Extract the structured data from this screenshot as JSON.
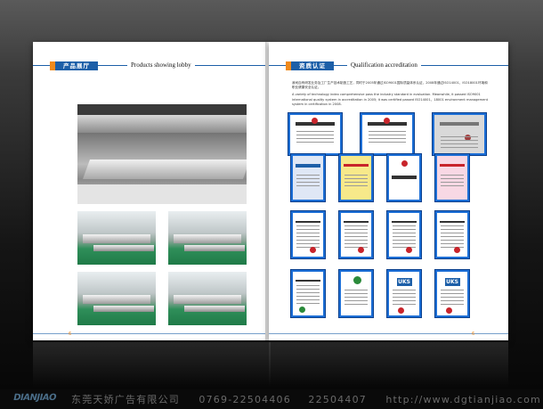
{
  "left_page": {
    "header": {
      "cn_label": "产品展厅",
      "en_title": "Products showing lobby"
    },
    "page_number": "6"
  },
  "right_page": {
    "header": {
      "cn_label": "资质认证",
      "en_title": "Qualification accreditation"
    },
    "intro_cn": "我司自有研发业务及工厂生产技术制造工艺，同时于2005年通过ISO9001国际质量体系认证，2008年通过ISO14001、ISO18001环境和职业健康安全认证。",
    "intro_en": "A variety of technology index comprehensive pass the industry standard in evaluation. Meanwhile, it passed ISO9001 international quality system in accreditation in 2005; it was certified passed ISO14001、18001 environment management system in certification in 2008.",
    "certificates": [
      {
        "kind": "license-cn"
      },
      {
        "kind": "license-cn"
      },
      {
        "kind": "license-grey"
      },
      {
        "kind": "cert-blue"
      },
      {
        "kind": "cert-yellow"
      },
      {
        "kind": "cert-plain"
      },
      {
        "kind": "cert-plain"
      },
      {
        "kind": "cert-pink"
      },
      {
        "kind": "cert-form"
      },
      {
        "kind": "cert-form"
      },
      {
        "kind": "cert-form"
      },
      {
        "kind": "cert-form"
      },
      {
        "kind": "cert-iso"
      },
      {
        "kind": "cert-iso-green"
      },
      {
        "kind": "cert-uks",
        "logo": "UKS"
      },
      {
        "kind": "cert-uks",
        "logo": "UKS"
      }
    ],
    "page_number": "6"
  },
  "footer": {
    "logo": "DIANJIAO",
    "company": "东莞天娇广告有限公司",
    "phone1": "0769-22504406",
    "phone2": "22504407",
    "url": "http://www.dgtianjiao.com"
  },
  "colors": {
    "brand_blue": "#1d5fa8",
    "accent_orange": "#f08a1c",
    "cert_frame": "#1d6fd6"
  }
}
